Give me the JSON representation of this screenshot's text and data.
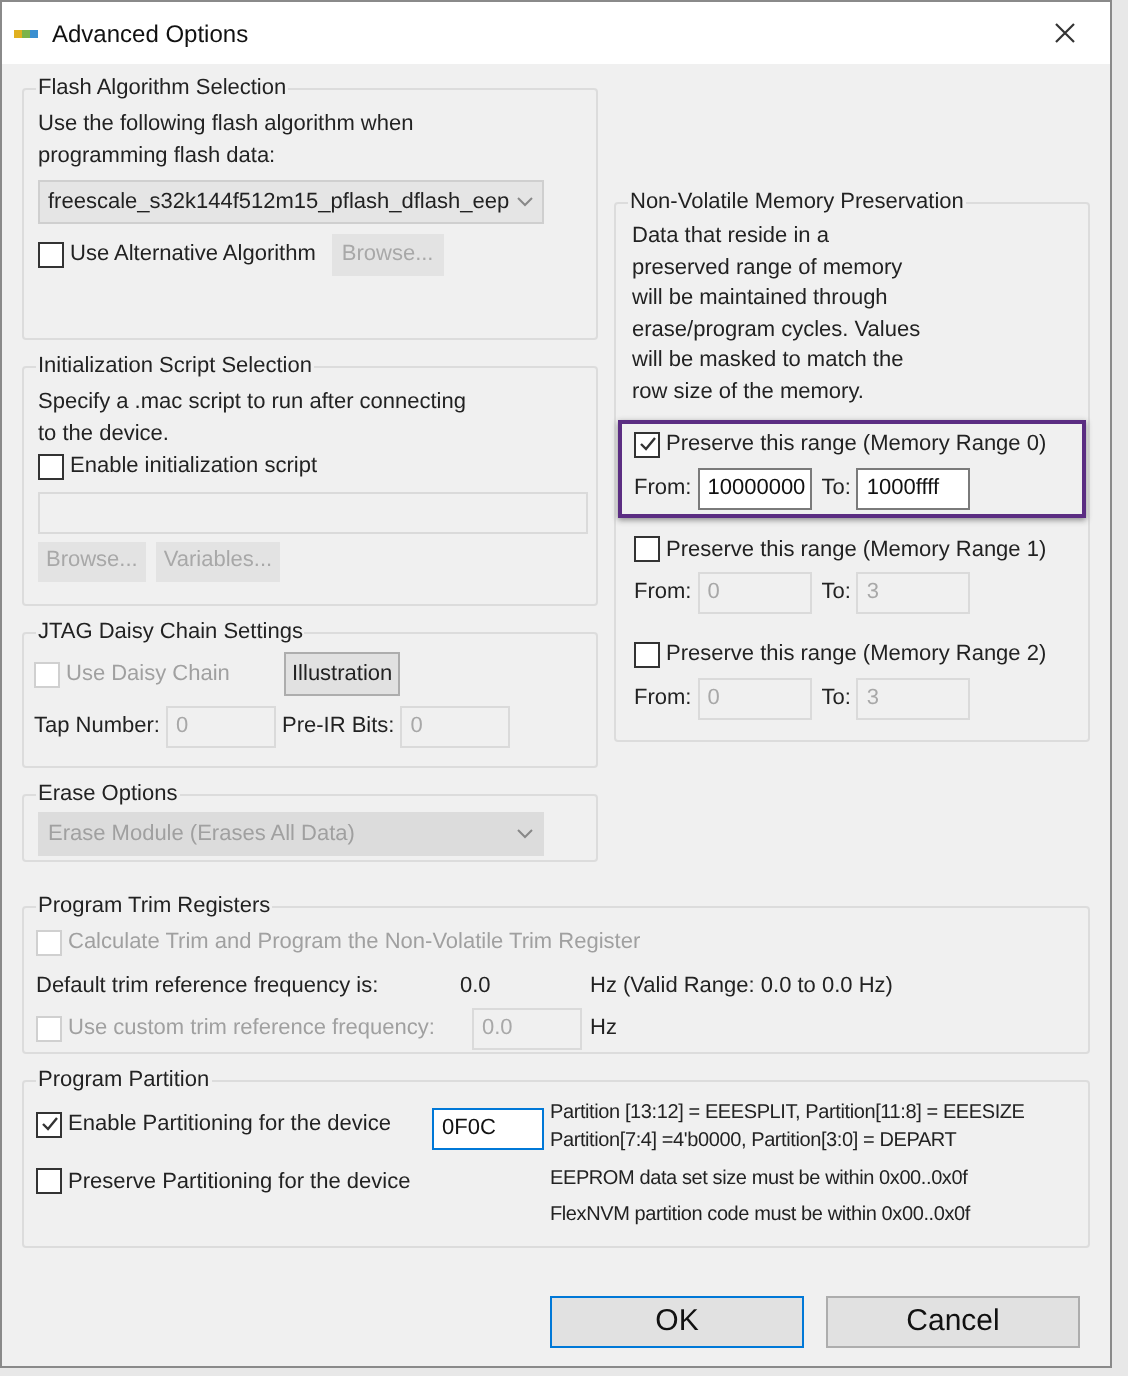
{
  "window": {
    "title": "Advanced Options"
  },
  "flash_algorithm": {
    "title": "Flash Algorithm Selection",
    "description": "Use the following flash algorithm when programming flash data:",
    "algorithm": "freescale_s32k144f512m15_pflash_dflash_eep",
    "alternative": {
      "label": "Use Alternative Algorithm",
      "checked": false,
      "disabled": false
    },
    "browse": {
      "label": "Browse...",
      "disabled": true
    }
  },
  "init_script": {
    "title": "Initialization Script Selection",
    "description": "Specify a .mac script to run after connecting to the device.",
    "enable": {
      "label": "Enable initialization script",
      "checked": false,
      "disabled": false
    },
    "buttons": [
      {
        "label": "Browse...",
        "disabled": true
      },
      {
        "label": "Variables...",
        "disabled": true
      }
    ]
  },
  "jtag": {
    "title": "JTAG Daisy Chain Settings",
    "daisy_chain": {
      "label": "Use Daisy Chain",
      "checked": false,
      "disabled": true
    },
    "illustration": {
      "label": "Illustration",
      "disabled": false
    },
    "fields": [
      {
        "label": "Tap Number:",
        "value": "0",
        "disabled": true
      },
      {
        "label": "Pre-IR Bits:",
        "value": "0",
        "disabled": true
      }
    ]
  },
  "erase": {
    "title": "Erase Options",
    "mode": "Erase Module (Erases All Data)",
    "disabled": true
  },
  "nvm": {
    "title": "Non-Volatile Memory Preservation",
    "description": "Data that reside in a preserved range of memory will be maintained through erase/program cycles. Values will be masked to match the row size of the memory.",
    "ranges": [
      {
        "label": "Preserve this range (Memory Range 0)",
        "checked": true,
        "highlighted": true,
        "from_label": "From:",
        "from": "10000000",
        "to_label": "To:",
        "to": "1000ffff"
      },
      {
        "label": "Preserve this range (Memory Range 1)",
        "checked": false,
        "highlighted": false,
        "from_label": "From:",
        "from": "0",
        "to_label": "To:",
        "to": "3"
      },
      {
        "label": "Preserve this range (Memory Range 2)",
        "checked": false,
        "highlighted": false,
        "from_label": "From:",
        "from": "0",
        "to_label": "To:",
        "to": "3"
      }
    ]
  },
  "trim": {
    "title": "Program Trim Registers",
    "calculate": {
      "label": "Calculate Trim and Program the Non-Volatile Trim Register",
      "checked": false,
      "disabled": true
    },
    "default_label": "Default trim reference frequency is:",
    "default_value": "0.0",
    "default_unit": "Hz (Valid Range: 0.0 to 0.0 Hz)",
    "custom": {
      "label": "Use custom trim reference frequency:",
      "checked": false,
      "disabled": true
    },
    "custom_value": "0.0",
    "custom_unit": "Hz"
  },
  "partition": {
    "title": "Program Partition",
    "enable": {
      "label": "Enable Partitioning for the device",
      "checked": true,
      "disabled": false
    },
    "value": "0F0C",
    "focused": true,
    "preserve": {
      "label": "Preserve Partitioning for the device",
      "checked": false,
      "disabled": false
    },
    "notes": [
      "Partition [13:12] = EEESPLIT, Partition[11:8] = EEESIZE",
      "Partition[7:4] =4'b0000, Partition[3:0] = DEPART",
      "EEPROM data set size must be within 0x00..0x0f",
      "FlexNVM partition code must be within 0x00..0x0f"
    ]
  },
  "buttons": [
    {
      "label": "OK",
      "default": true
    },
    {
      "label": "Cancel",
      "default": false
    }
  ]
}
